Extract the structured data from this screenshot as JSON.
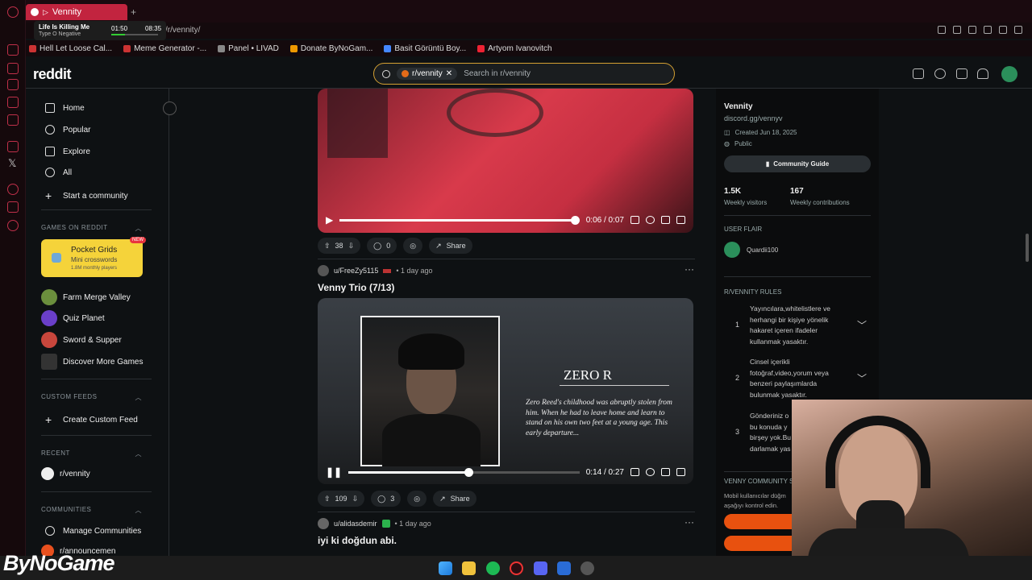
{
  "browser": {
    "tab_title": "Vennity",
    "url": "/r/vennity/"
  },
  "media_player": {
    "track": "Life Is Killing Me",
    "artist": "Type O Negative",
    "elapsed": "01:50",
    "total": "08:35"
  },
  "bookmarks": [
    "Hell Let Loose Cal...",
    "Meme Generator -...",
    "Panel • LIVAD",
    "Donate ByNoGam...",
    "Basit Görüntü Boy...",
    "Artyom Ivanovitch"
  ],
  "header": {
    "logo": "reddit",
    "chip": "r/vennity",
    "search_placeholder": "Search in r/vennity"
  },
  "sidebar": {
    "nav": [
      "Home",
      "Popular",
      "Explore",
      "All",
      "Start a community"
    ],
    "games_title": "GAMES ON REDDIT",
    "featured": {
      "name": "Pocket Grids",
      "sub": "Mini crosswords",
      "players": "1.8M monthly players",
      "badge": "NEW"
    },
    "games": [
      "Farm Merge Valley",
      "Quiz Planet",
      "Sword & Supper",
      "Discover More Games"
    ],
    "custom_title": "CUSTOM FEEDS",
    "create_feed": "Create Custom Feed",
    "recent_title": "RECENT",
    "recent": "r/vennity",
    "communities_title": "COMMUNITIES",
    "manage": "Manage Communities",
    "announce": "r/announcemen"
  },
  "posts": [
    {
      "time": "0:06 / 0:07",
      "progress": 0.98,
      "votes": "38",
      "comments": "0",
      "share": "Share"
    },
    {
      "author": "u/FreeZy5115",
      "age": "• 1 day ago",
      "title": "Venny Trio (7/13)",
      "time": "0:14 / 0:27",
      "progress": 0.52,
      "votes": "109",
      "comments": "3",
      "share": "Share",
      "overlay_name": "ZERO R",
      "overlay_text": "Zero Reed's childhood was abruptly stolen from him. When he had to leave home and learn to stand on his own two feet at a young age. This early departure..."
    },
    {
      "author": "u/alidasdemir",
      "age": "• 1 day ago",
      "title": "iyi ki doğdun abi."
    }
  ],
  "community": {
    "name": "Vennity",
    "link": "discord.gg/vennyv",
    "created": "Created Jun 18, 2025",
    "visibility": "Public",
    "guide": "Community Guide",
    "visitors": "1.5K",
    "visitors_label": "Weekly visitors",
    "contribs": "167",
    "contribs_label": "Weekly contributions",
    "flair_title": "USER FLAIR",
    "flair_user": "Quardii100",
    "rules_title": "R/VENNITY RULES",
    "rules": [
      {
        "n": "1",
        "text": "Yayıncılara,whitelistlere ve herhangi bir kişiye yönelik hakaret içeren ifadeler kullanmak yasaktır."
      },
      {
        "n": "2",
        "text": "Cinsel içerikli fotoğraf,video,yorum veya benzeri paylaşımlarda bulunmak yasaktır."
      },
      {
        "n": "3",
        "text": "Gönderiniz o bu konuda y birşey yok.Bu darlamak yas"
      }
    ],
    "mobile_title": "VENNY COMMUNITY S",
    "mobile_text": "Mobil kullanıcılar düğm aşağıyı kontrol edin."
  },
  "watermark": "ByNoGame"
}
